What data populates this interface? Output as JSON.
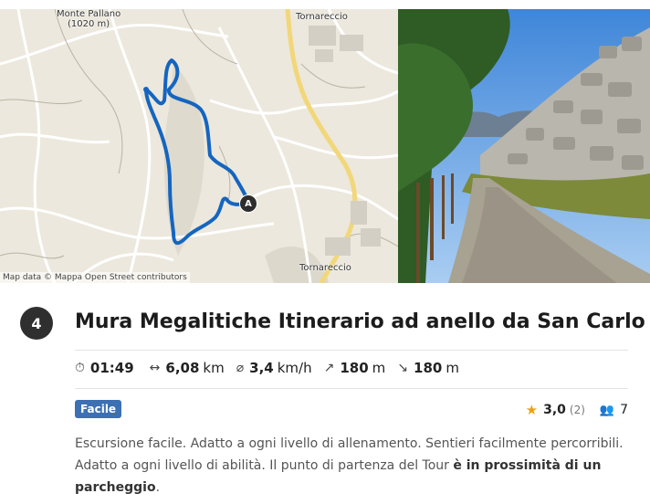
{
  "map": {
    "label_peak": "Monte Pallano",
    "label_peak_elev": "(1020 m)",
    "label_town_north": "Tornareccio",
    "label_town_south": "Tornareccio",
    "start_marker": "A",
    "attribution": "Map data © Mappa Open Street contributors",
    "route_color": "#1565c0"
  },
  "tour": {
    "index": "4",
    "title": "Mura Megalitiche Itinerario ad anello da San Carlo",
    "duration": "01:49",
    "distance_value": "6,08",
    "distance_unit": "km",
    "speed_value": "3,4",
    "speed_unit": "km/h",
    "ascent_value": "180",
    "ascent_unit": "m",
    "descent_value": "180",
    "descent_unit": "m",
    "difficulty": "Facile",
    "difficulty_color": "#3d70b2",
    "rating": "3,0",
    "rating_count": "(2)",
    "people_count": "7",
    "description_plain": "Escursione facile. Adatto a ogni livello di allenamento. Sentieri facilmente percorribili. Adatto a ogni livello di abilità. Il punto di partenza del Tour ",
    "description_bold": "è in prossimità di un parcheggio",
    "description_end": "."
  }
}
